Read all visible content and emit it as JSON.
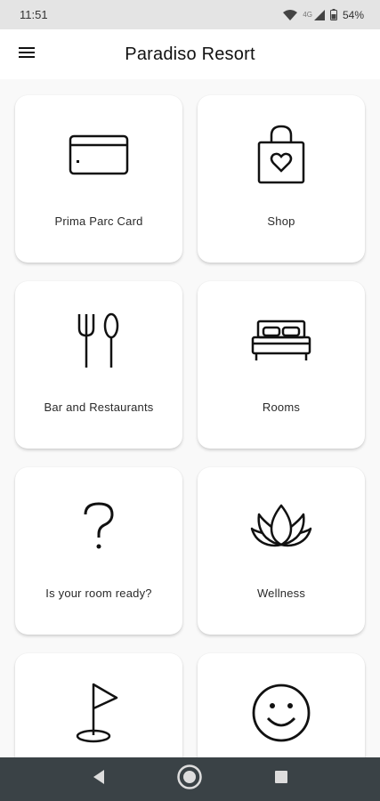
{
  "status_bar": {
    "time": "11:51",
    "network_label": "4G",
    "battery": "54%"
  },
  "app_bar": {
    "title": "Paradiso Resort",
    "menu_icon": "hamburger-menu-icon"
  },
  "tiles": [
    {
      "label": "Prima Parc Card",
      "icon": "credit-card-icon"
    },
    {
      "label": "Shop",
      "icon": "shopping-bag-heart-icon"
    },
    {
      "label": "Bar and Restaurants",
      "icon": "fork-spoon-icon"
    },
    {
      "label": "Rooms",
      "icon": "bed-icon"
    },
    {
      "label": "Is your room ready?",
      "icon": "question-mark-icon"
    },
    {
      "label": "Wellness",
      "icon": "lotus-icon"
    },
    {
      "label": "",
      "icon": "golf-flag-icon"
    },
    {
      "label": "",
      "icon": "smiley-face-icon"
    }
  ],
  "nav_bar": {
    "back_icon": "back-triangle-icon",
    "home_icon": "home-circle-icon",
    "recents_icon": "recents-square-icon"
  },
  "colors": {
    "status_bar_bg": "#e4e4e4",
    "app_bar_bg": "#ffffff",
    "content_bg": "#f9f9f9",
    "card_bg": "#ffffff",
    "nav_bar_bg": "#3a4246",
    "icon_stroke": "#111111"
  }
}
